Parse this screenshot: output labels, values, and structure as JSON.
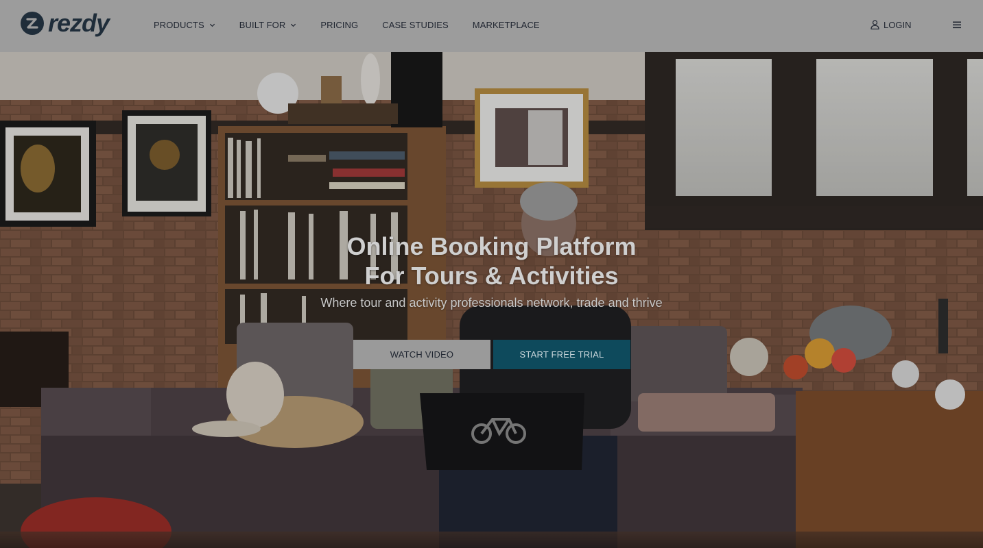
{
  "brand": {
    "logo_text": "rezdy",
    "logo_icon": "rezdy-logo-icon"
  },
  "nav": {
    "items": [
      {
        "label": "PRODUCTS",
        "has_dropdown": true
      },
      {
        "label": "BUILT FOR",
        "has_dropdown": true
      },
      {
        "label": "PRICING",
        "has_dropdown": false
      },
      {
        "label": "CASE STUDIES",
        "has_dropdown": false
      },
      {
        "label": "MARKETPLACE",
        "has_dropdown": false
      }
    ],
    "login_label": "LOGIN",
    "login_icon": "user-icon",
    "menu_icon": "hamburger-menu-icon"
  },
  "hero": {
    "title_line1": "Online Booking Platform",
    "title_line2": "For Tours & Activities",
    "subtitle": "Where tour and activity professionals network, trade and thrive",
    "watch_video_label": "WATCH VIDEO",
    "start_trial_label": "START FREE TRIAL"
  },
  "colors": {
    "header_bg": "#9c9c9c",
    "brand_dark": "#1f2d3a",
    "trial_button": "#0e4a5c",
    "video_button": "#9a9a9a"
  }
}
